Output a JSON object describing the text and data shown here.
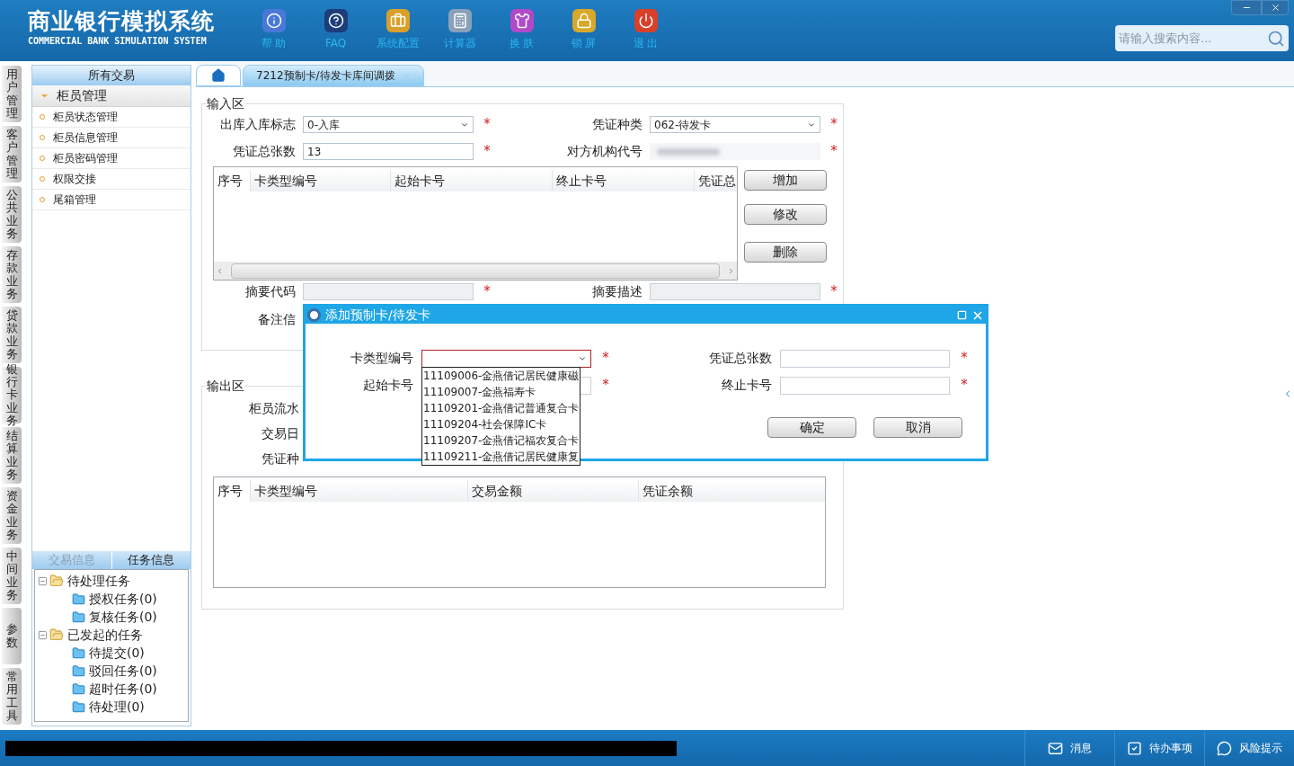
{
  "app": {
    "title": "商业银行模拟系统",
    "subtitle": "COMMERCIAL BANK SIMULATION SYSTEM"
  },
  "toolbar": [
    {
      "kind": "info",
      "label": "帮 助"
    },
    {
      "kind": "faq",
      "label": "FAQ"
    },
    {
      "kind": "config",
      "label": "系统配置"
    },
    {
      "kind": "calculator",
      "label": "计算器"
    },
    {
      "kind": "skin",
      "label": "换 肤"
    },
    {
      "kind": "lock",
      "label": "锁 屏"
    },
    {
      "kind": "exit",
      "label": "退 出"
    }
  ],
  "search": {
    "placeholder": "请输入搜索内容..."
  },
  "side_tabs": [
    "用户管理",
    "客户管理",
    "公共业务",
    "存款业务",
    "贷款业务",
    "银行卡业务",
    "结算业务",
    "资金业务",
    "中间业务",
    "参数",
    "常用工具"
  ],
  "sidebar": {
    "title": "所有交易",
    "group": {
      "label": "柜员管理",
      "expanded": true,
      "items": [
        "柜员状态管理",
        "柜员信息管理",
        "柜员密码管理",
        "权限交接",
        "尾箱管理"
      ]
    }
  },
  "info_tabs": [
    {
      "label": "交易信息",
      "selected": false
    },
    {
      "label": "任务信息",
      "selected": true
    }
  ],
  "task_tree": [
    {
      "label": "待处理任务",
      "expanded": true,
      "children": [
        {
          "label": "授权任务(0)"
        },
        {
          "label": "复核任务(0)"
        }
      ]
    },
    {
      "label": "已发起的任务",
      "expanded": true,
      "children": [
        {
          "label": "待提交(0)"
        },
        {
          "label": "驳回任务(0)"
        },
        {
          "label": "超时任务(0)"
        },
        {
          "label": "待处理(0)"
        }
      ]
    }
  ],
  "tabs": [
    {
      "kind": "home",
      "selected": false
    },
    {
      "kind": "page",
      "label": "7212预制卡/待发卡库间调拨",
      "selected": true
    }
  ],
  "input_area": {
    "title": "输入区",
    "rows": [
      [
        {
          "label": "出库入库标志",
          "kind": "select",
          "value": "0-入库",
          "mark": "*"
        },
        {
          "label": "凭证种类",
          "kind": "select",
          "value": "062-待发卡",
          "mark": "*"
        }
      ],
      [
        {
          "label": "凭证总张数",
          "kind": "text",
          "value": "13",
          "mark": "*"
        },
        {
          "label": "对方机构代号",
          "kind": "masked",
          "mark": "*"
        }
      ]
    ],
    "table": {
      "columns": [
        "序号",
        "卡类型编号",
        "起始卡号",
        "终止卡号",
        "凭证总"
      ]
    },
    "buttons": [
      "增加",
      "修改",
      "删除"
    ],
    "rows2": [
      [
        {
          "label": "摘要代码",
          "kind": "disabled",
          "mark": "*"
        },
        {
          "label": "摘要描述",
          "kind": "disabled",
          "mark": "*"
        }
      ],
      [
        {
          "label": "备注信",
          "kind": "label"
        }
      ]
    ]
  },
  "output_area": {
    "title": "输出区",
    "labels": [
      "柜员流水",
      "交易日",
      "凭证种"
    ],
    "table": {
      "columns": [
        "序号",
        "卡类型编号",
        "交易金额",
        "凭证余额"
      ]
    }
  },
  "dialog": {
    "title": "添加预制卡/待发卡",
    "fields": [
      {
        "label": "卡类型编号",
        "kind": "select",
        "focused": true,
        "mark": "*"
      },
      {
        "label": "凭证总张数",
        "kind": "text",
        "focused": false,
        "mark": "*"
      },
      {
        "label": "起始卡号",
        "kind": "text",
        "focused": false,
        "mark": "*"
      },
      {
        "label": "终止卡号",
        "kind": "text",
        "focused": false,
        "mark": "*"
      }
    ],
    "options": [
      "11109006-金燕借记居民健康磁",
      "11109007-金燕福寿卡",
      "11109201-金燕借记普通复合卡",
      "11109204-社会保障IC卡",
      "11109207-金燕借记福农复合卡",
      "11109211-金燕借记居民健康复"
    ],
    "buttons": [
      "确定",
      "取消"
    ]
  },
  "status_bar": [
    {
      "kind": "message",
      "label": "消息"
    },
    {
      "kind": "todo",
      "label": "待办事项"
    },
    {
      "kind": "risk",
      "label": "风险提示"
    }
  ]
}
